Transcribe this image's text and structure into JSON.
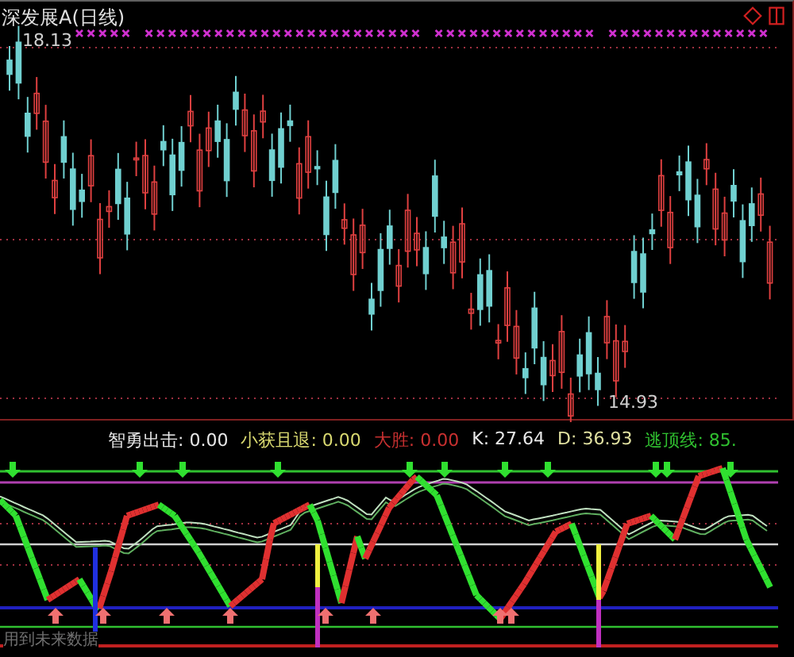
{
  "main_chart": {
    "title": "深发展A(日线)",
    "high_label": "18.13",
    "low_label": "14.93"
  },
  "indicator": {
    "readings": [
      {
        "name": "智勇出击:",
        "value": "0.00",
        "color": "#e8e8e8"
      },
      {
        "name": "小获且退:",
        "value": "0.00",
        "color": "#d8d870"
      },
      {
        "name": "大胜:",
        "value": "0.00",
        "color": "#c83030"
      },
      {
        "name": "K:",
        "value": "27.64",
        "color": "#e8e8e8"
      },
      {
        "name": "D:",
        "value": "36.93",
        "color": "#e0e0a0"
      },
      {
        "name": "逃顶线:",
        "value": "85.",
        "color": "#30c030"
      }
    ],
    "warning": "用到未来数据"
  }
}
